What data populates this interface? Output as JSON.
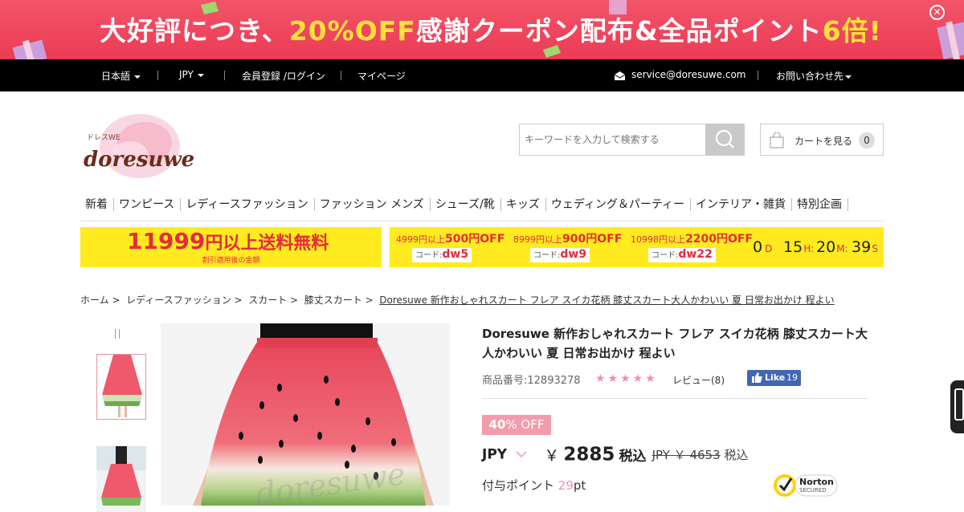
{
  "promo": {
    "part1": "大好評につき、",
    "part2": "20%OFF",
    "part3": "感謝クーポン配布&全品ポイント",
    "part4": "6倍!",
    "close_icon": "close-icon"
  },
  "topbar": {
    "language": "日本語",
    "currency": "JPY",
    "login": "会員登録 /ログイン",
    "mypage": "マイページ",
    "email": "service@doresuwe.com",
    "contact": "お問い合わせ先"
  },
  "logo": {
    "small": "ドレスWE",
    "main": "doresuwe"
  },
  "search": {
    "placeholder": "キーワードを入力して検索する"
  },
  "cart": {
    "label": "カートを見る",
    "count": "0"
  },
  "nav": [
    "新着",
    "ワンピース",
    "レディースファッション",
    "ファッション メンズ",
    "シューズ/靴",
    "キッズ",
    "ウェディング＆パーティー",
    "インテリア・雑貨",
    "特別企画"
  ],
  "banner_shipping": {
    "amount": "11999",
    "text": "円以上送料無料",
    "sub": "割引適用後の金額"
  },
  "coupons": [
    {
      "cond": "4999円以上",
      "off": "500円OFF",
      "code_label": "コード:",
      "code": "dw5"
    },
    {
      "cond": "8999円以上",
      "off": "900円OFF",
      "code_label": "コード:",
      "code": "dw9"
    },
    {
      "cond": "10998円以上",
      "off": "2200円OFF",
      "code_label": "コード:",
      "code": "dw22"
    }
  ],
  "countdown": {
    "d": "0",
    "d_unit": "D",
    "h": "15",
    "h_unit": "H:",
    "m": "20",
    "m_unit": "M:",
    "s": "39",
    "s_unit": "S"
  },
  "breadcrumb": [
    "ホーム >",
    "レディースファッション >",
    "スカート >",
    "膝丈スカート >",
    "Doresuwe 新作おしゃれスカート フレア スイカ花柄 膝丈スカート大人かわいい 夏 日常お出かけ 程よい"
  ],
  "product": {
    "title": "Doresuwe 新作おしゃれスカート フレア スイカ花柄 膝丈スカート大人かわいい 夏 日常お出かけ 程よい",
    "sku": "商品番号:12893278",
    "stars": "★★★★★",
    "reviews": "レビュー(8)",
    "like_label": "Like",
    "like_count": "19",
    "discount_pct": "40",
    "discount_suffix": "% OFF",
    "currency": "JPY",
    "yen": "￥",
    "price": "2885",
    "tax": "税込",
    "old_currency": "JPY ￥",
    "old_price": "4653",
    "old_tax": "税込",
    "points_label": "付与ポイント",
    "points": "29",
    "points_unit": "pt",
    "watermark": "doresuwe"
  },
  "norton": {
    "name": "Norton",
    "sub": "SECURED"
  },
  "colors": {
    "promo": "#ec3b55",
    "accent": "#e62a3c",
    "pink": "#f39cae",
    "banner": "#ffeb1f"
  }
}
